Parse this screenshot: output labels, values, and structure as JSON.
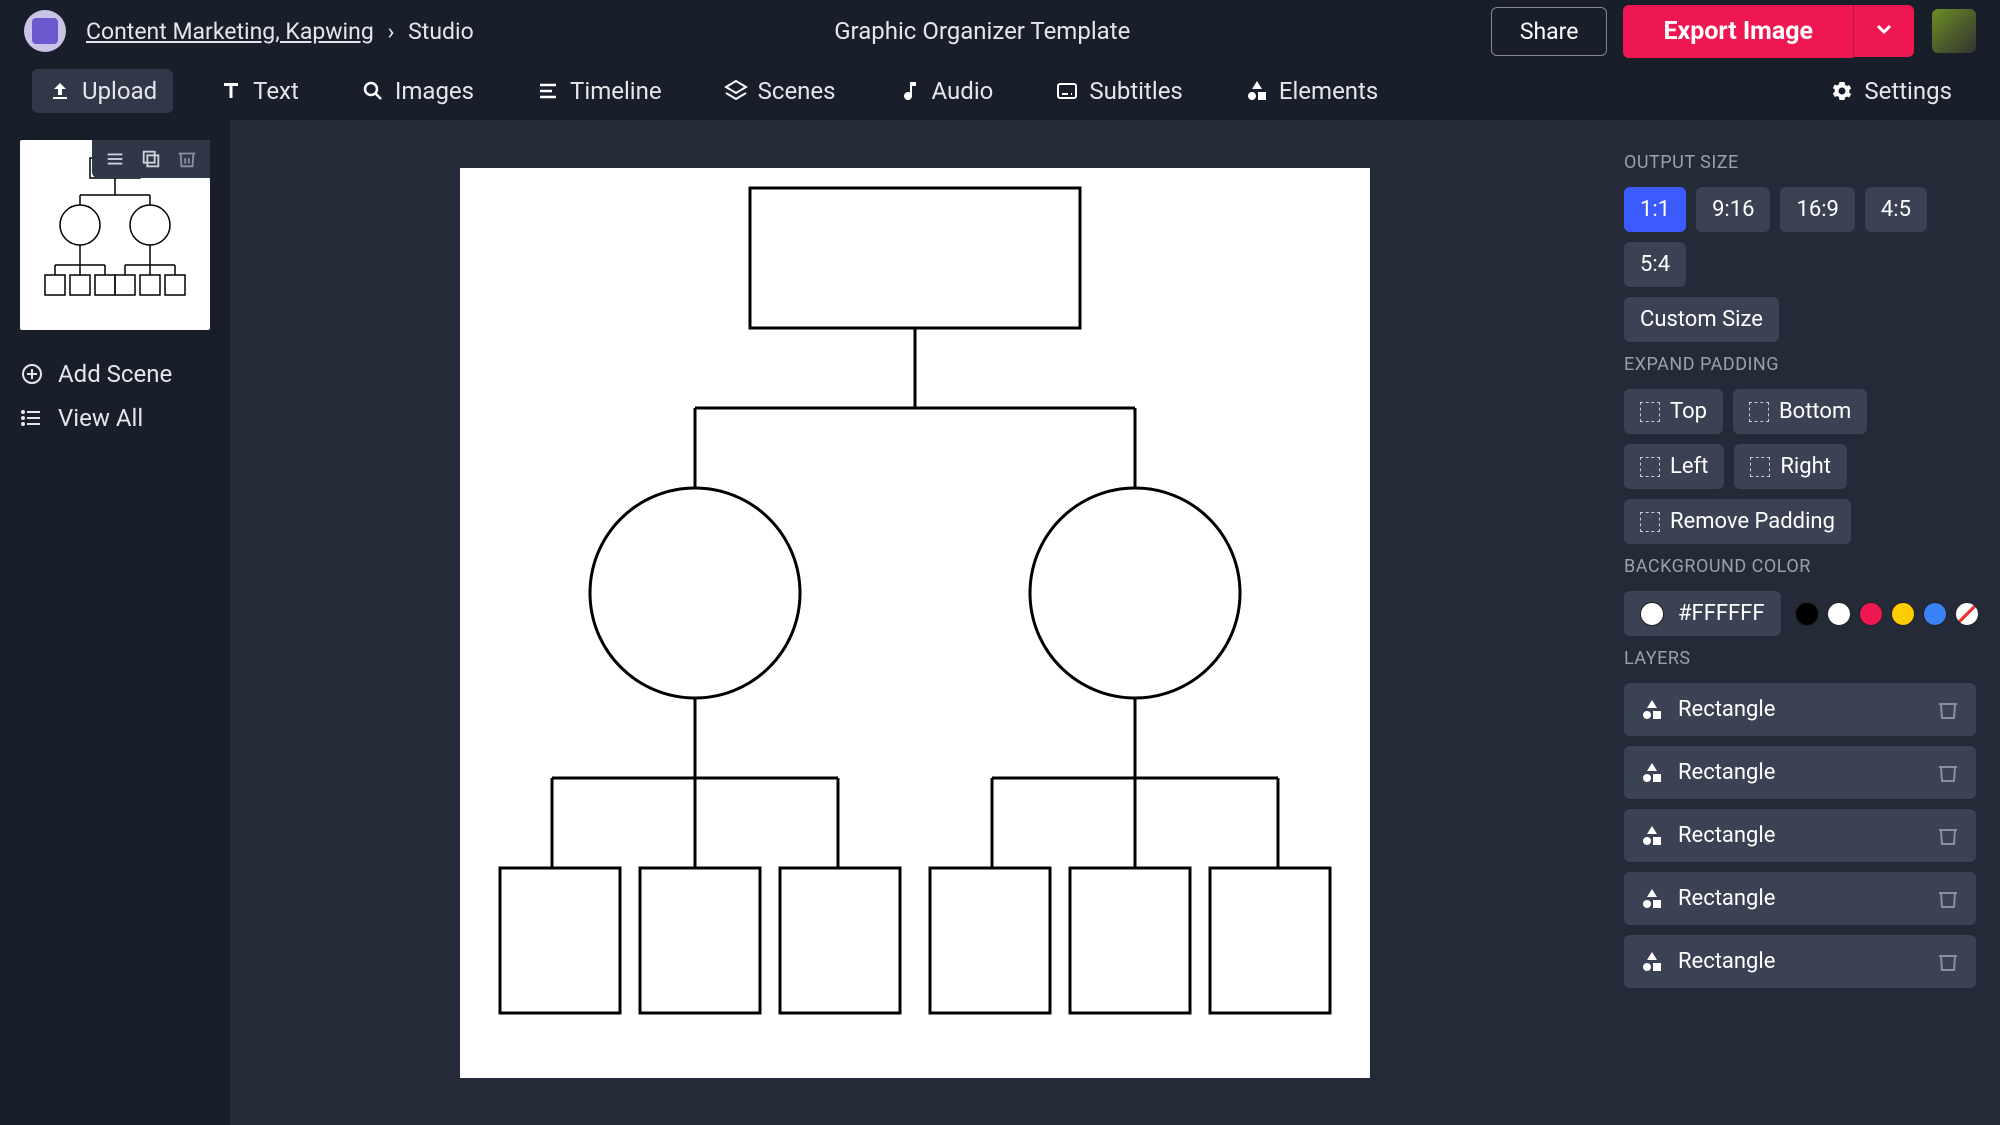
{
  "header": {
    "workspace": "Content Marketing, Kapwing",
    "studio": "Studio",
    "title": "Graphic Organizer Template",
    "share": "Share",
    "export": "Export Image"
  },
  "menu": {
    "upload": "Upload",
    "text": "Text",
    "images": "Images",
    "timeline": "Timeline",
    "scenes": "Scenes",
    "audio": "Audio",
    "subtitles": "Subtitles",
    "elements": "Elements",
    "settings": "Settings"
  },
  "left": {
    "add_scene": "Add Scene",
    "view_all": "View All"
  },
  "right": {
    "output_size": "OUTPUT SIZE",
    "ratios": [
      "1:1",
      "9:16",
      "16:9",
      "4:5",
      "5:4"
    ],
    "ratio_active": "1:1",
    "custom_size": "Custom Size",
    "expand_padding": "EXPAND PADDING",
    "pad_top": "Top",
    "pad_bottom": "Bottom",
    "pad_left": "Left",
    "pad_right": "Right",
    "remove_padding": "Remove Padding",
    "background_color": "BACKGROUND COLOR",
    "bg_hex": "#FFFFFF",
    "layers_label": "LAYERS",
    "layers": [
      "Rectangle",
      "Rectangle",
      "Rectangle",
      "Rectangle",
      "Rectangle"
    ]
  }
}
